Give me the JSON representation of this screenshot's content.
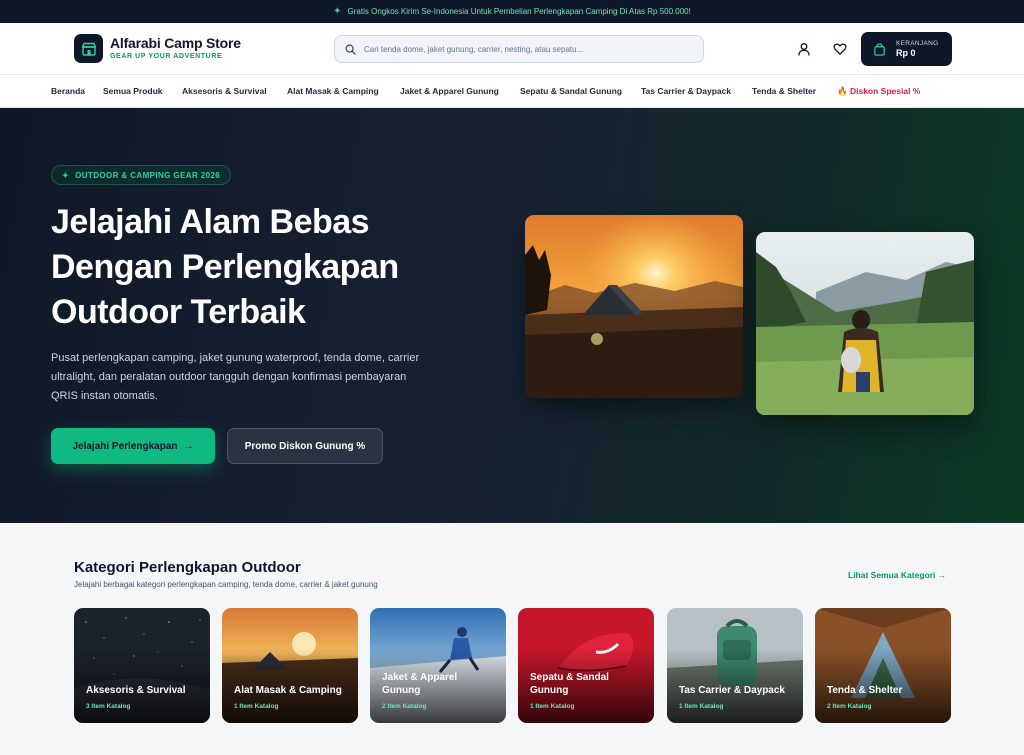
{
  "announcement": {
    "text": "Gratis Ongkos Kirim Se-Indonesia Untuk Pembelian Perlengkapan Camping Di Atas Rp 500.000!",
    "icon": "sparkle-icon"
  },
  "header": {
    "store_name": "Alfarabi Camp Store",
    "tagline": "GEAR UP YOUR ADVENTURE",
    "search_placeholder": "Cari tenda dome, jaket gunung, carrier, nesting, atau sepatu...",
    "cart_label": "KERANJANG",
    "cart_total": "Rp 0"
  },
  "nav": {
    "items": [
      "Beranda",
      "Semua Produk",
      "Aksesoris & Survival",
      "Alat Masak & Camping",
      "Jaket & Apparel Gunung",
      "Sepatu & Sandal Gunung",
      "Tas Carrier & Daypack",
      "Tenda & Shelter"
    ],
    "promo": "Diskon Spesial %"
  },
  "hero": {
    "badge": "OUTDOOR & CAMPING GEAR 2026",
    "title_lines": [
      "Jelajahi Alam Bebas",
      "Dengan Perlengkapan",
      "Outdoor Terbaik"
    ],
    "description": "Pusat perlengkapan camping, jaket gunung waterproof, tenda dome, carrier ultralight, dan peralatan outdoor tangguh dengan konfirmasi pembayaran QRIS instan otomatis.",
    "primary_button": "Jelajahi Perlengkapan",
    "secondary_button": "Promo Diskon Gunung %"
  },
  "categories": {
    "title": "Kategori Perlengkapan Outdoor",
    "subtitle": "Jelajahi berbagai kategori perlengkapan camping, tenda dome, carrier & jaket gunung",
    "view_all": "Lihat Semua Kategori",
    "items": [
      {
        "name": "Aksesoris & Survival",
        "count": "3 Item Katalog"
      },
      {
        "name": "Alat Masak & Camping",
        "count": "1 Item Katalog"
      },
      {
        "name": "Jaket & Apparel Gunung",
        "count": "2 Item Katalog"
      },
      {
        "name": "Sepatu & Sandal Gunung",
        "count": "1 Item Katalog"
      },
      {
        "name": "Tas Carrier & Daypack",
        "count": "1 Item Katalog"
      },
      {
        "name": "Tenda & Shelter",
        "count": "2 Item Katalog"
      }
    ]
  },
  "colors": {
    "brand_dark": "#0f172a",
    "accent": "#10b981",
    "promo": "#e11d48",
    "tagline": "#059669"
  }
}
